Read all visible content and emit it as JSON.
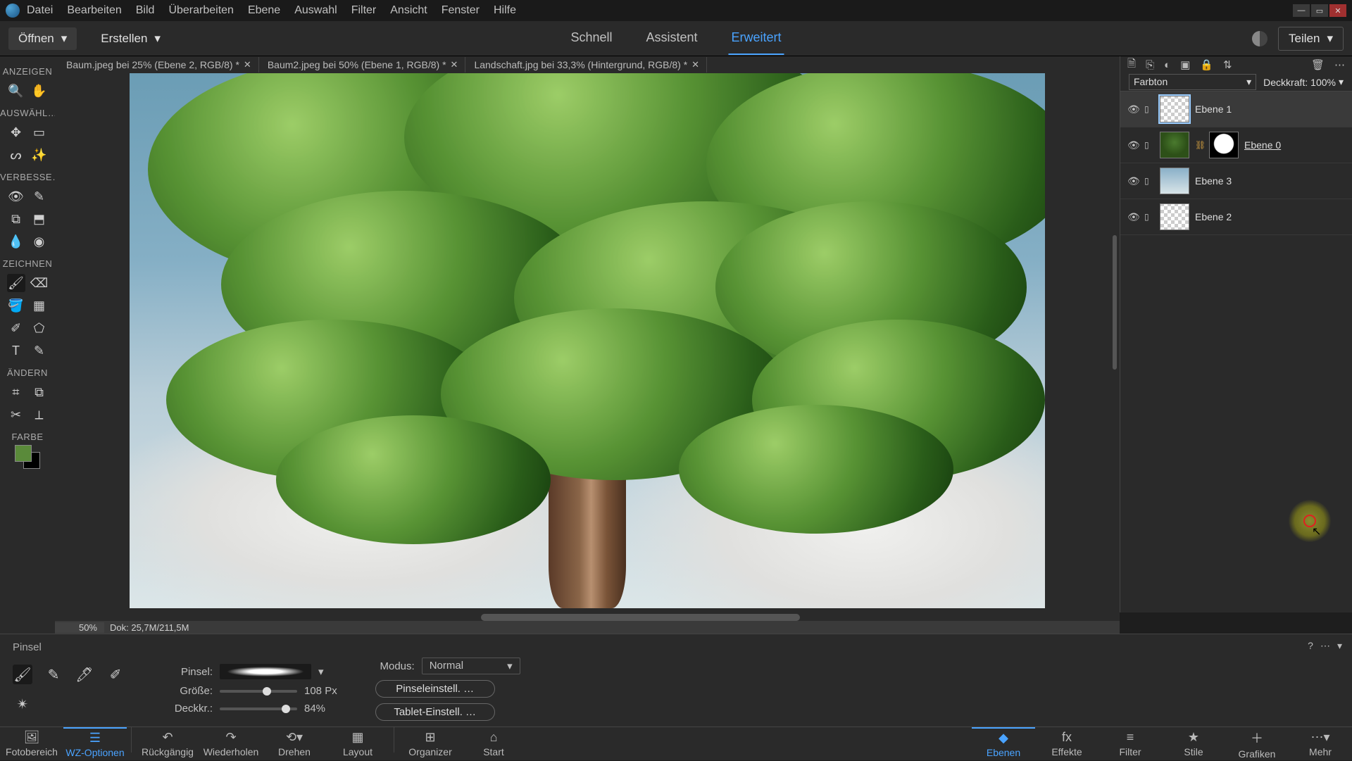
{
  "menubar": [
    "Datei",
    "Bearbeiten",
    "Bild",
    "Überarbeiten",
    "Ebene",
    "Auswahl",
    "Filter",
    "Ansicht",
    "Fenster",
    "Hilfe"
  ],
  "secondbar": {
    "open": "Öffnen",
    "create": "Erstellen",
    "share": "Teilen",
    "modes": [
      "Schnell",
      "Assistent",
      "Erweitert"
    ],
    "active_mode": 2
  },
  "tools": {
    "sections": {
      "anzeigen": "ANZEIGEN",
      "auswaehlen": "AUSWÄHL…",
      "verbessern": "VERBESSE…",
      "zeichnen": "ZEICHNEN",
      "aendern": "ÄNDERN",
      "farbe": "FARBE"
    }
  },
  "tabs": [
    {
      "title": "Baum.jpeg bei 25% (Ebene 2, RGB/8) *"
    },
    {
      "title": "Baum2.jpeg bei 50% (Ebene 1, RGB/8) *"
    },
    {
      "title": "Landschaft.jpg bei 33,3% (Hintergrund, RGB/8) *"
    }
  ],
  "status": {
    "zoom": "50%",
    "dok": "Dok: 25,7M/211,5M"
  },
  "options": {
    "tool": "Pinsel",
    "brush_label": "Pinsel:",
    "mode_label": "Modus:",
    "mode_value": "Normal",
    "size_label": "Größe:",
    "size_value": "108 Px",
    "opacity_label": "Deckkr.:",
    "opacity_value": "84%",
    "brush_settings": "Pinseleinstell. …",
    "tablet_settings": "Tablet-Einstell. …"
  },
  "taskbar": {
    "left": [
      {
        "label": "Fotobereich"
      },
      {
        "label": "WZ-Optionen",
        "active": true
      },
      {
        "label": "Rückgängig"
      },
      {
        "label": "Wiederholen"
      },
      {
        "label": "Drehen"
      },
      {
        "label": "Layout"
      }
    ],
    "mid": [
      {
        "label": "Organizer"
      },
      {
        "label": "Start"
      }
    ],
    "right": [
      {
        "label": "Ebenen",
        "active": true
      },
      {
        "label": "Effekte"
      },
      {
        "label": "Filter"
      },
      {
        "label": "Stile"
      },
      {
        "label": "Grafiken"
      },
      {
        "label": "Mehr"
      }
    ]
  },
  "layers": {
    "blend_label": "Farbton",
    "opacity_label": "Deckkraft:",
    "opacity_value": "100%",
    "items": [
      {
        "name": "Ebene 1",
        "checker": true,
        "selected": true
      },
      {
        "name": "Ebene 0",
        "tree": true,
        "mask": true,
        "underline": true,
        "linked": true
      },
      {
        "name": "Ebene 3",
        "sky": true
      },
      {
        "name": "Ebene 2",
        "checker": true
      }
    ]
  }
}
